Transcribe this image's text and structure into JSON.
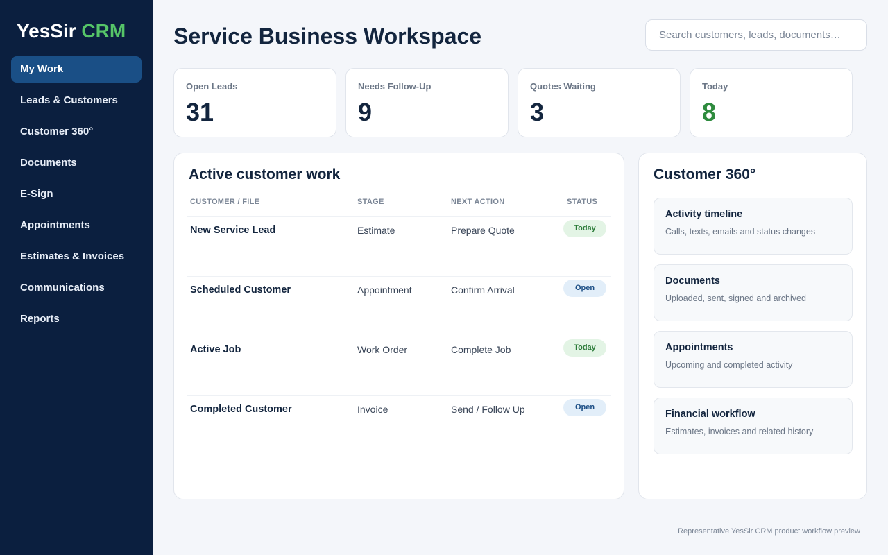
{
  "brand": {
    "name": "YesSir",
    "accent": "CRM"
  },
  "sidebar": {
    "items": [
      {
        "label": "My Work",
        "active": true
      },
      {
        "label": "Leads & Customers"
      },
      {
        "label": "Customer 360°"
      },
      {
        "label": "Documents"
      },
      {
        "label": "E-Sign"
      },
      {
        "label": "Appointments"
      },
      {
        "label": "Estimates & Invoices"
      },
      {
        "label": "Communications"
      },
      {
        "label": "Reports"
      }
    ]
  },
  "header": {
    "title": "Service Business Workspace",
    "search_placeholder": "Search customers, leads, documents…"
  },
  "stats": [
    {
      "label": "Open Leads",
      "value": "31"
    },
    {
      "label": "Needs Follow-Up",
      "value": "9"
    },
    {
      "label": "Quotes Waiting",
      "value": "3"
    },
    {
      "label": "Today",
      "value": "8"
    }
  ],
  "work": {
    "title": "Active customer work",
    "columns": [
      "CUSTOMER / FILE",
      "STAGE",
      "NEXT ACTION",
      "STATUS"
    ],
    "rows": [
      {
        "name": "New Service Lead",
        "stage": "Estimate",
        "next": "Prepare Quote",
        "status": "Today"
      },
      {
        "name": "Scheduled Customer",
        "stage": "Appointment",
        "next": "Confirm Arrival",
        "status": "Open"
      },
      {
        "name": "Active Job",
        "stage": "Work Order",
        "next": "Complete Job",
        "status": "Today"
      },
      {
        "name": "Completed Customer",
        "stage": "Invoice",
        "next": "Send / Follow Up",
        "status": "Open"
      }
    ]
  },
  "customer360": {
    "title": "Customer 360°",
    "tiles": [
      {
        "title": "Activity timeline",
        "desc": "Calls, texts, emails and status changes"
      },
      {
        "title": "Documents",
        "desc": "Uploaded, sent, signed and archived"
      },
      {
        "title": "Appointments",
        "desc": "Upcoming and completed activity"
      },
      {
        "title": "Financial workflow",
        "desc": "Estimates, invoices and related history"
      }
    ]
  },
  "footer": {
    "text": "Representative YesSir CRM product workflow preview"
  },
  "colors": {
    "sidebar": "#0b1f3f",
    "accent_green": "#56c568",
    "active_nav": "#1a4f86"
  }
}
